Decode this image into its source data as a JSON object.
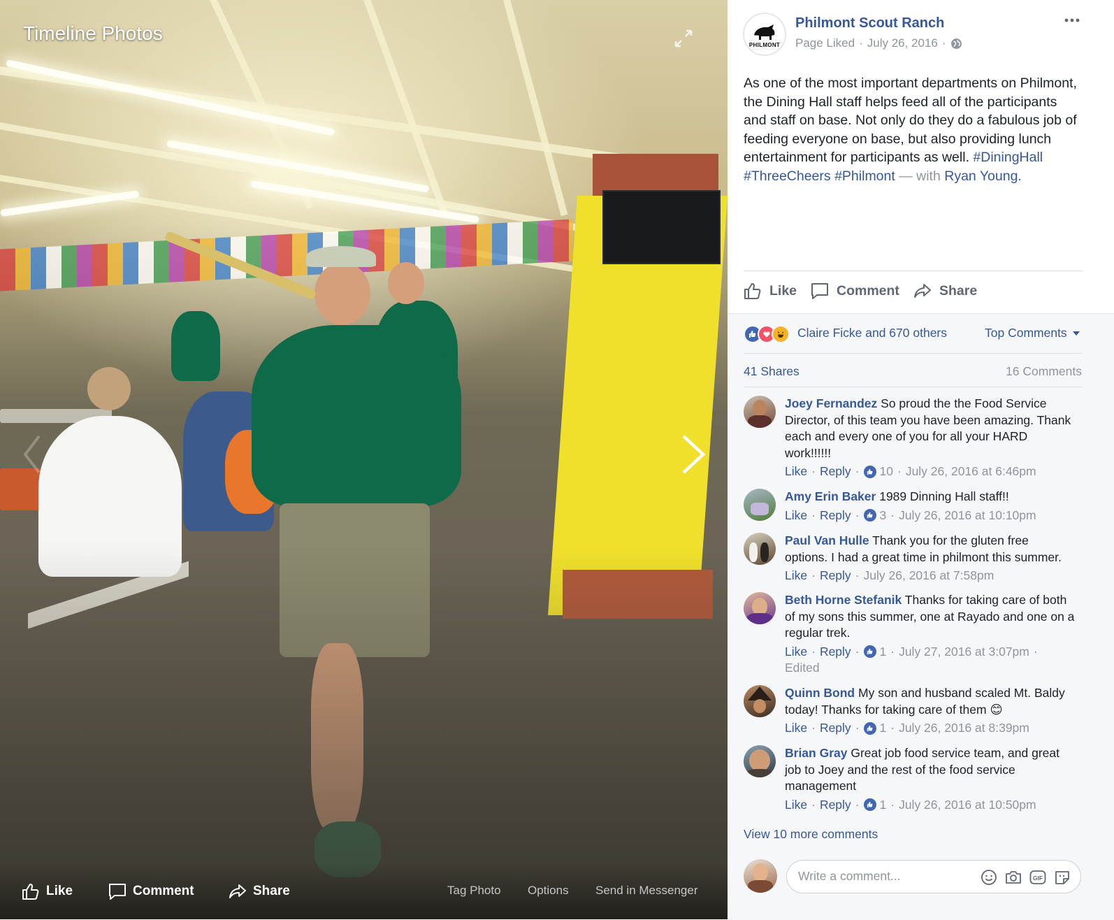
{
  "photo": {
    "title": "Timeline Photos",
    "actions": {
      "like": "Like",
      "comment": "Comment",
      "share": "Share"
    },
    "links": {
      "tag": "Tag Photo",
      "options": "Options",
      "send": "Send in Messenger"
    }
  },
  "post": {
    "page_name": "Philmont Scout Ranch",
    "avatar_text": "PHILMONT",
    "status": "Page Liked",
    "sep": "·",
    "date": "July 26, 2016",
    "text": "As one of the most important departments on Philmont, the Dining Hall staff helps feed all of the participants and staff on base. Not only do they do a fabulous job of feeding everyone on base, but also providing lunch entertainment for participants as well. ",
    "hashtags": [
      "#DiningHall",
      "#ThreeCheers",
      "#Philmont"
    ],
    "with_text": " — with",
    "tagged": "Ryan Young."
  },
  "actions": {
    "like": "Like",
    "comment": "Comment",
    "share": "Share"
  },
  "feedback": {
    "reactions_text": "Claire Ficke and 670 others",
    "top_comments": "Top Comments",
    "shares": "41 Shares",
    "comments_count": "16 Comments"
  },
  "comments": [
    {
      "name": "Joey Fernandez",
      "text": "So proud the the Food Service Director, of this team you have been amazing. Thank each and every one of you for all your HARD work!!!!!!",
      "like": "Like",
      "reply": "Reply",
      "likes": "10",
      "time": "July 26, 2016 at 6:46pm",
      "edited": "",
      "colors": [
        "#7a4a33",
        "#c9c0b4"
      ]
    },
    {
      "name": "Amy Erin Baker",
      "text": "1989 Dinning Hall staff!!",
      "like": "Like",
      "reply": "Reply",
      "likes": "3",
      "time": "July 26, 2016 at 10:10pm",
      "edited": "",
      "colors": [
        "#4f7d3a",
        "#a8b6c7"
      ]
    },
    {
      "name": "Paul Van Hulle",
      "text": "Thank you for the gluten free options. I had a great time in philmont this summer.",
      "like": "Like",
      "reply": "Reply",
      "likes": "",
      "time": "July 26, 2016 at 7:58pm",
      "edited": "",
      "colors": [
        "#5a4530",
        "#d8d2c0"
      ]
    },
    {
      "name": "Beth Horne Stefanik",
      "text": "Thanks for taking care of both of my sons this summer, one at Rayado and one on a regular trek.",
      "like": "Like",
      "reply": "Reply",
      "likes": "1",
      "time": "July 27, 2016 at 3:07pm",
      "edited": "Edited",
      "colors": [
        "#6a3a8c",
        "#e0b89a"
      ]
    },
    {
      "name": "Quinn Bond",
      "text": "My son and husband scaled Mt. Baldy today! Thanks for taking care of them",
      "emoji": "😊",
      "like": "Like",
      "reply": "Reply",
      "likes": "1",
      "time": "July 26, 2016 at 8:39pm",
      "edited": "",
      "colors": [
        "#3c2c22",
        "#b88a63"
      ]
    },
    {
      "name": "Brian Gray",
      "text": "Great job food service team, and great job to Joey and the rest of the food service management",
      "like": "Like",
      "reply": "Reply",
      "likes": "1",
      "time": "July 26, 2016 at 10:50pm",
      "edited": "",
      "colors": [
        "#2f3a42",
        "#cf9c78"
      ]
    }
  ],
  "view_more": "View 10 more comments",
  "composer": {
    "placeholder": "Write a comment..."
  },
  "colors": {
    "link": "#365899",
    "muted": "#90949c",
    "text": "#1d2129",
    "like_blue": "#4267b2",
    "love_red": "#f25268",
    "haha_yellow": "#f7b125"
  },
  "icons": [
    "expand-icon",
    "next-arrow-icon",
    "more-icon",
    "globe-icon",
    "thumbs-up-icon",
    "comment-bubble-icon",
    "share-arrow-icon",
    "caret-down-icon",
    "smiley-icon",
    "camera-icon",
    "gif-icon",
    "sticker-icon"
  ]
}
